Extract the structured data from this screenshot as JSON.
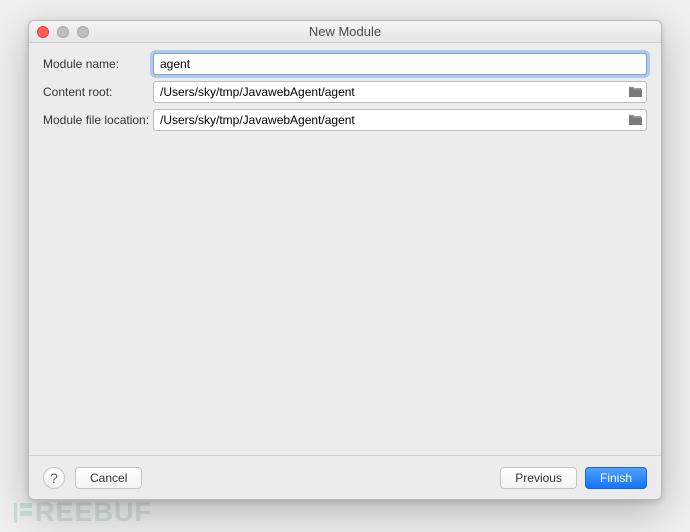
{
  "window": {
    "title": "New Module"
  },
  "form": {
    "module_name": {
      "label": "Module name:",
      "value": "agent"
    },
    "content_root": {
      "label": "Content root:",
      "value": "/Users/sky/tmp/JavawebAgent/agent"
    },
    "module_file_location": {
      "label": "Module file location:",
      "value": "/Users/sky/tmp/JavawebAgent/agent"
    }
  },
  "buttons": {
    "help": "?",
    "cancel": "Cancel",
    "previous": "Previous",
    "finish": "Finish"
  },
  "watermark": {
    "text": "REEBUF"
  }
}
